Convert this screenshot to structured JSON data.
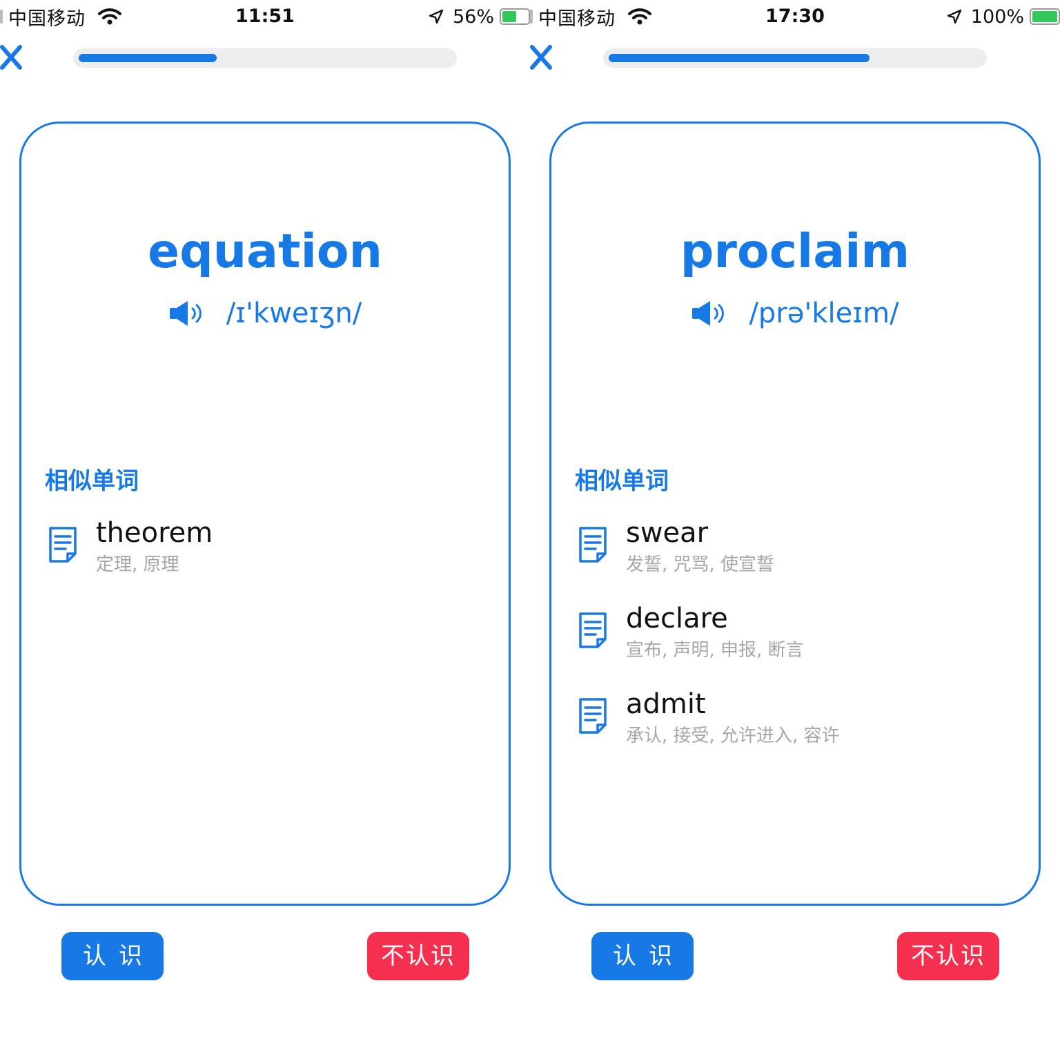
{
  "screens": [
    {
      "status": {
        "carrier": "中国移动",
        "time": "11:51",
        "battery_pct": "56%",
        "battery_level": 0.56
      },
      "progress": 0.37,
      "word": "equation",
      "phonetic": "/ɪ'kweɪʒn/",
      "similar_title": "相似单词",
      "similar": [
        {
          "word": "theorem",
          "meaning": "定理, 原理"
        }
      ],
      "know_label": "认识",
      "unknown_label": "不认识"
    },
    {
      "status": {
        "carrier": "中国移动",
        "time": "17:30",
        "battery_pct": "100%",
        "battery_level": 1.0
      },
      "progress": 0.7,
      "word": "proclaim",
      "phonetic": "/prə'kleɪm/",
      "similar_title": "相似单词",
      "similar": [
        {
          "word": "swear",
          "meaning": "发誓, 咒骂, 使宣誓"
        },
        {
          "word": "declare",
          "meaning": "宣布, 声明, 申报, 断言"
        },
        {
          "word": "admit",
          "meaning": "承认, 接受, 允许进入, 容许"
        }
      ],
      "know_label": "认识",
      "unknown_label": "不认识"
    }
  ],
  "colors": {
    "accent": "#1779e6",
    "danger": "#f5304f",
    "muted": "#a6a6a6",
    "battery": "#34c759"
  },
  "icons": [
    "wifi-icon",
    "location-icon",
    "battery-icon",
    "close-icon",
    "speaker-icon",
    "document-icon"
  ]
}
